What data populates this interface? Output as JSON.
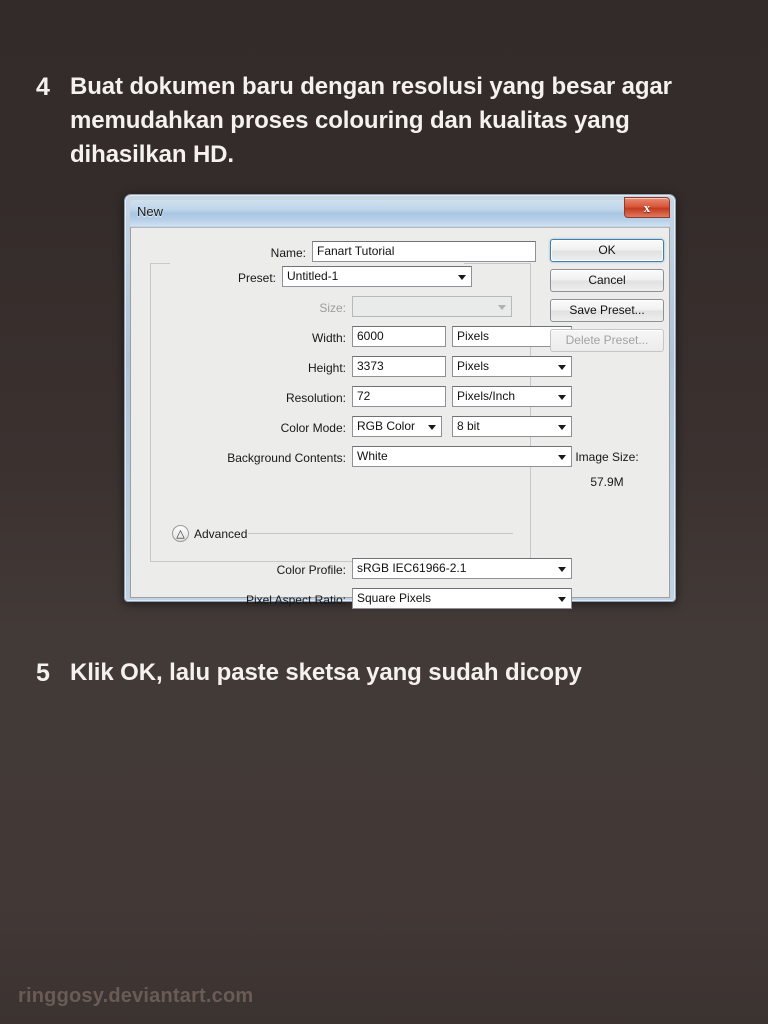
{
  "page": {
    "background_color": "#342c2a",
    "watermark": "ringgosy.deviantart.com"
  },
  "steps": [
    {
      "number": "4",
      "text": "Buat dokumen baru dengan resolusi yang besar agar memudahkan proses colouring dan kualitas yang dihasilkan HD."
    },
    {
      "number": "5",
      "text": "Klik OK, lalu paste sketsa yang sudah dicopy"
    }
  ],
  "dialog": {
    "title": "New",
    "close_label": "x",
    "close_icon": "close-icon",
    "fields": {
      "name_label": "Name:",
      "name_value": "Fanart Tutorial",
      "preset_label": "Preset:",
      "preset_value": "Untitled-1",
      "size_label": "Size:",
      "size_value": "",
      "width_label": "Width:",
      "width_value": "6000",
      "width_unit": "Pixels",
      "height_label": "Height:",
      "height_value": "3373",
      "height_unit": "Pixels",
      "resolution_label": "Resolution:",
      "resolution_value": "72",
      "resolution_unit": "Pixels/Inch",
      "color_mode_label": "Color Mode:",
      "color_mode_value": "RGB Color",
      "color_depth_value": "8 bit",
      "background_contents_label": "Background Contents:",
      "background_contents_value": "White",
      "advanced_label": "Advanced",
      "advanced_toggle_icon": "chevron-double-up-icon",
      "color_profile_label": "Color Profile:",
      "color_profile_value": "sRGB IEC61966-2.1",
      "pixel_aspect_label": "Pixel Aspect Ratio:",
      "pixel_aspect_value": "Square Pixels"
    },
    "buttons": {
      "ok": "OK",
      "cancel": "Cancel",
      "save_preset": "Save Preset...",
      "delete_preset": "Delete Preset..."
    },
    "image_size": {
      "title": "Image Size:",
      "value": "57.9M"
    }
  }
}
